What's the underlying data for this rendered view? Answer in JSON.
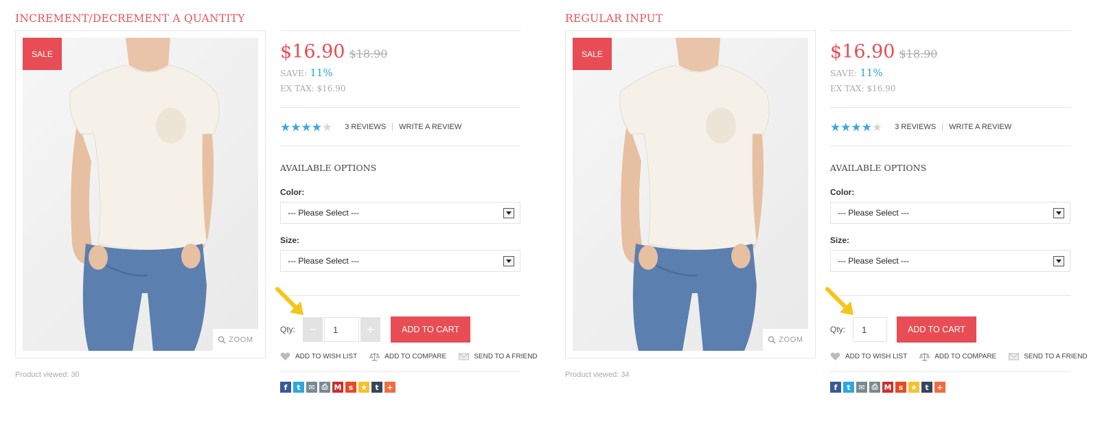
{
  "panels": [
    {
      "title": "INCREMENT/DECREMENT A QUANTITY",
      "sale_label": "SALE",
      "zoom_label": "ZOOM",
      "product_viewed": "Product viewed: 30",
      "price_new": "$16.90",
      "price_old": "$18.90",
      "save_label": "SAVE:",
      "save_value": "11%",
      "ex_tax": "EX TAX: $16.90",
      "rating": 4,
      "rating_max": 5,
      "reviews": "3 REVIEWS",
      "write_review": "WRITE A REVIEW",
      "options_title": "AVAILABLE OPTIONS",
      "color_label": "Color:",
      "color_value": "--- Please Select ---",
      "size_label": "Size:",
      "size_value": "--- Please Select ---",
      "qty_label": "Qty:",
      "qty_value": "1",
      "decrement_label": "−",
      "increment_label": "+",
      "add_to_cart": "ADD TO CART",
      "wish_list": "ADD TO WISH LIST",
      "compare": "ADD TO COMPARE",
      "send_friend": "SEND TO A FRIEND"
    },
    {
      "title": "REGULAR INPUT",
      "sale_label": "SALE",
      "zoom_label": "ZOOM",
      "product_viewed": "Product viewed: 34",
      "price_new": "$16.90",
      "price_old": "$18.90",
      "save_label": "SAVE:",
      "save_value": "11%",
      "ex_tax": "EX TAX: $16.90",
      "rating": 4,
      "rating_max": 5,
      "reviews": "3 REVIEWS",
      "write_review": "WRITE A REVIEW",
      "options_title": "AVAILABLE OPTIONS",
      "color_label": "Color:",
      "color_value": "--- Please Select ---",
      "size_label": "Size:",
      "size_value": "--- Please Select ---",
      "qty_label": "Qty:",
      "qty_value": "1",
      "add_to_cart": "ADD TO CART",
      "wish_list": "ADD TO WISH LIST",
      "compare": "ADD TO COMPARE",
      "send_friend": "SEND TO A FRIEND"
    }
  ],
  "share_icons": [
    {
      "name": "facebook-icon",
      "glyph": "f",
      "color": "#3b5998"
    },
    {
      "name": "twitter-icon",
      "glyph": "t",
      "color": "#2ca7e0"
    },
    {
      "name": "email-icon",
      "glyph": "✉",
      "color": "#7a8a8f"
    },
    {
      "name": "print-icon",
      "glyph": "⎙",
      "color": "#7a8a8f"
    },
    {
      "name": "gmail-icon",
      "glyph": "M",
      "color": "#c9302c"
    },
    {
      "name": "stumbleupon-icon",
      "glyph": "s",
      "color": "#eb4924"
    },
    {
      "name": "favorites-icon",
      "glyph": "★",
      "color": "#f5c12e"
    },
    {
      "name": "tumblr-icon",
      "glyph": "t",
      "color": "#35465c"
    },
    {
      "name": "more-share-icon",
      "glyph": "+",
      "color": "#f26c3f"
    }
  ],
  "colors": {
    "accent": "#e84c54",
    "star": "#3ba9d9",
    "save": "#28a6d8",
    "arrow": "#f5c518"
  }
}
